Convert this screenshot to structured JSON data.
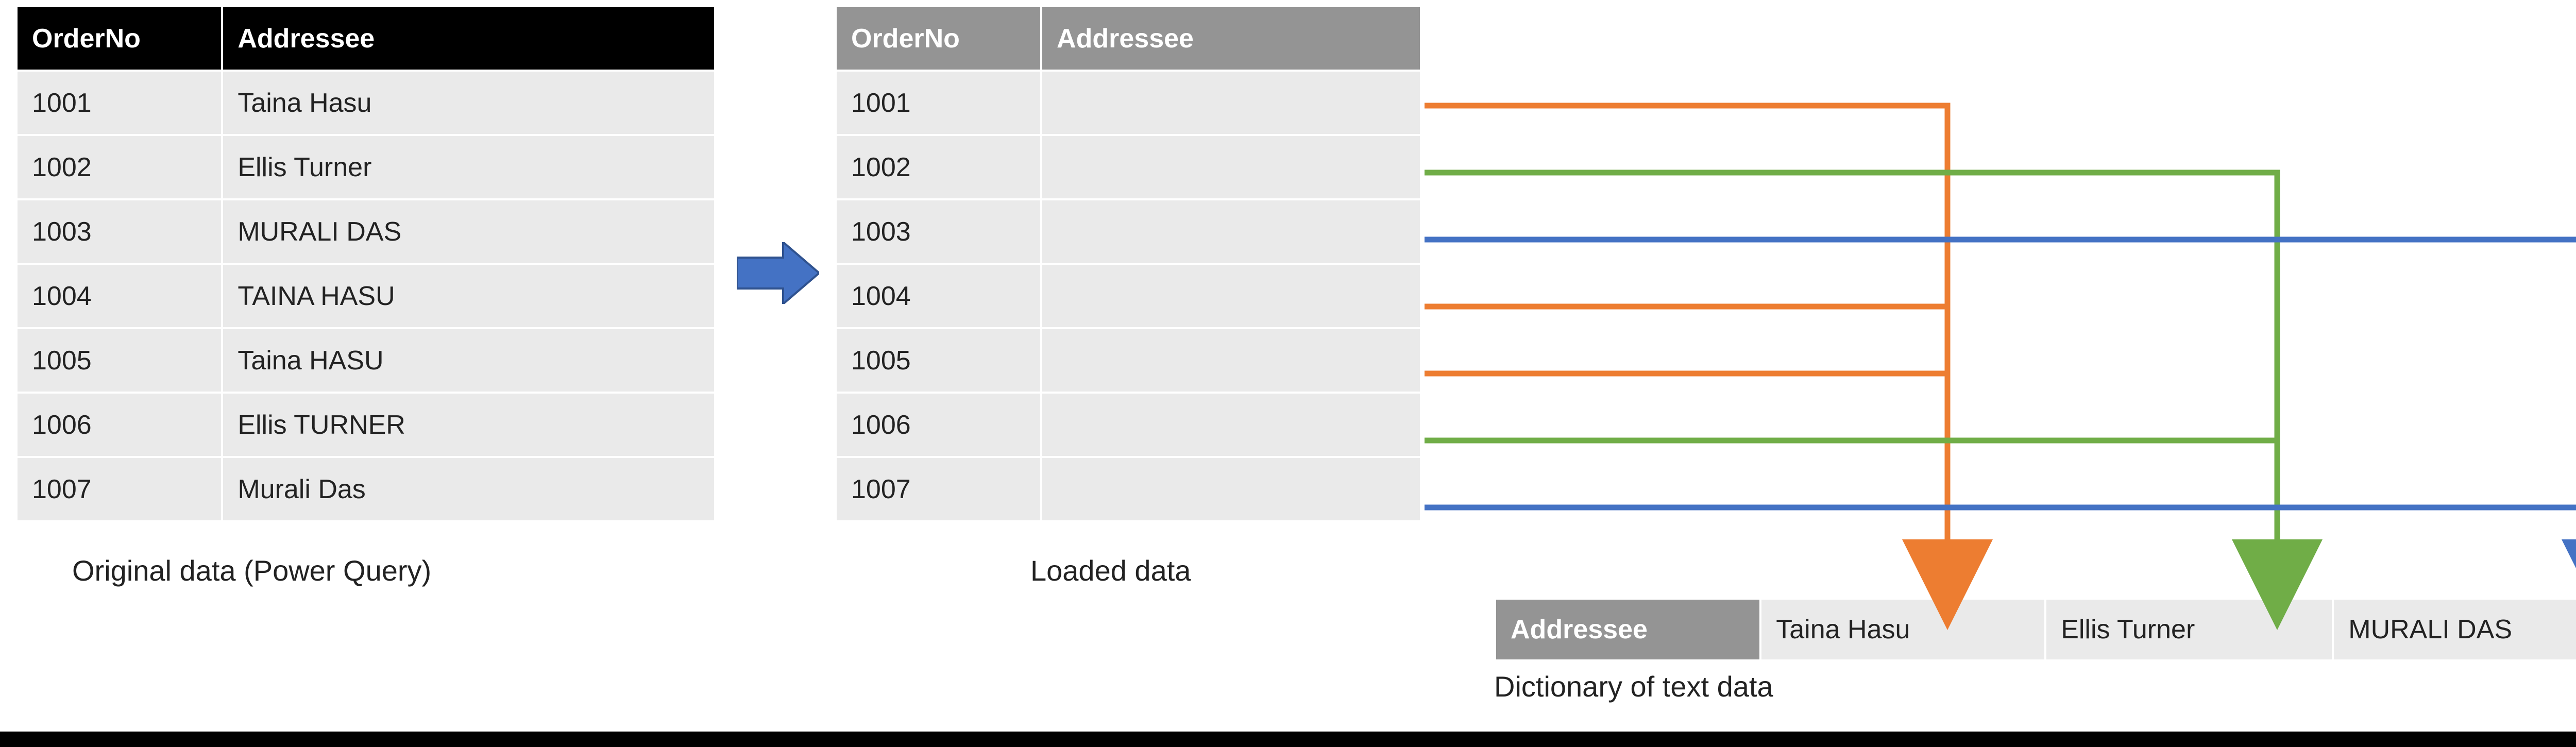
{
  "original": {
    "caption": "Original data (Power Query)",
    "columns": [
      "OrderNo",
      "Addressee"
    ],
    "rows": [
      {
        "orderNo": "1001",
        "addressee": "Taina Hasu"
      },
      {
        "orderNo": "1002",
        "addressee": "Ellis Turner"
      },
      {
        "orderNo": "1003",
        "addressee": "MURALI DAS"
      },
      {
        "orderNo": "1004",
        "addressee": "TAINA HASU"
      },
      {
        "orderNo": "1005",
        "addressee": "Taina HASU"
      },
      {
        "orderNo": "1006",
        "addressee": "Ellis TURNER"
      },
      {
        "orderNo": "1007",
        "addressee": "Murali Das"
      }
    ]
  },
  "loaded": {
    "caption": "Loaded data",
    "columns": [
      "OrderNo",
      "Addressee"
    ],
    "rows": [
      {
        "orderNo": "1001",
        "addressee": "",
        "dictRef": 0
      },
      {
        "orderNo": "1002",
        "addressee": "",
        "dictRef": 1
      },
      {
        "orderNo": "1003",
        "addressee": "",
        "dictRef": 2
      },
      {
        "orderNo": "1004",
        "addressee": "",
        "dictRef": 0
      },
      {
        "orderNo": "1005",
        "addressee": "",
        "dictRef": 0
      },
      {
        "orderNo": "1006",
        "addressee": "",
        "dictRef": 1
      },
      {
        "orderNo": "1007",
        "addressee": "",
        "dictRef": 2
      }
    ]
  },
  "dictionary": {
    "caption": "Dictionary of text data",
    "header": "Addressee",
    "entries": [
      "Taina Hasu",
      "Ellis Turner",
      "MURALI DAS"
    ]
  },
  "colors": {
    "orange": "#ed7d31",
    "green": "#70ad47",
    "blue": "#4472c4",
    "headerDark": "#000000",
    "headerGrey": "#949494",
    "cellBg": "#eaeaea"
  }
}
